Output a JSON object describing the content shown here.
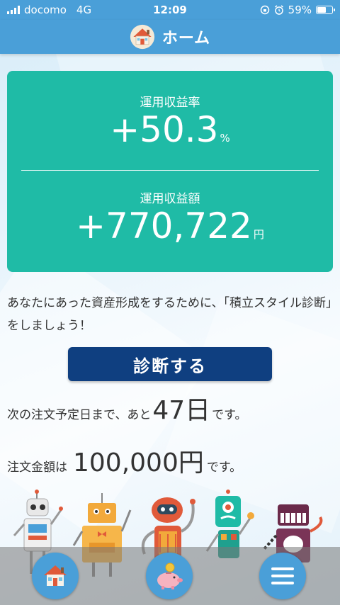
{
  "status_bar": {
    "carrier": "docomo",
    "network": "4G",
    "time": "12:09",
    "battery_percent": "59%",
    "battery_level": 0.59
  },
  "header": {
    "title": "ホーム",
    "icon": "house-icon"
  },
  "summary_card": {
    "return_rate_label": "運用収益率",
    "return_rate_value": "+50.3",
    "return_rate_unit": "%",
    "return_amount_label": "運用収益額",
    "return_amount_value": "+770,722",
    "return_amount_unit": "円",
    "background_color": "#1fbba6"
  },
  "message": "あなたにあった資産形成をするために、「積立スタイル診断」をしましょう！",
  "diagnose_button": {
    "label": "診断する",
    "color": "#0f3f80"
  },
  "next_order": {
    "prefix": "次の注文予定日まで、あと",
    "days": "47日",
    "suffix": "です。"
  },
  "order_amount": {
    "prefix": "注文金額は",
    "amount": "100,000円",
    "suffix": "です。"
  },
  "bottom_nav": {
    "items": [
      {
        "name": "home",
        "icon": "house-icon"
      },
      {
        "name": "savings",
        "icon": "piggy-bank-icon"
      },
      {
        "name": "menu",
        "icon": "hamburger-menu-icon"
      }
    ],
    "accent_color": "#4a9fd8"
  }
}
